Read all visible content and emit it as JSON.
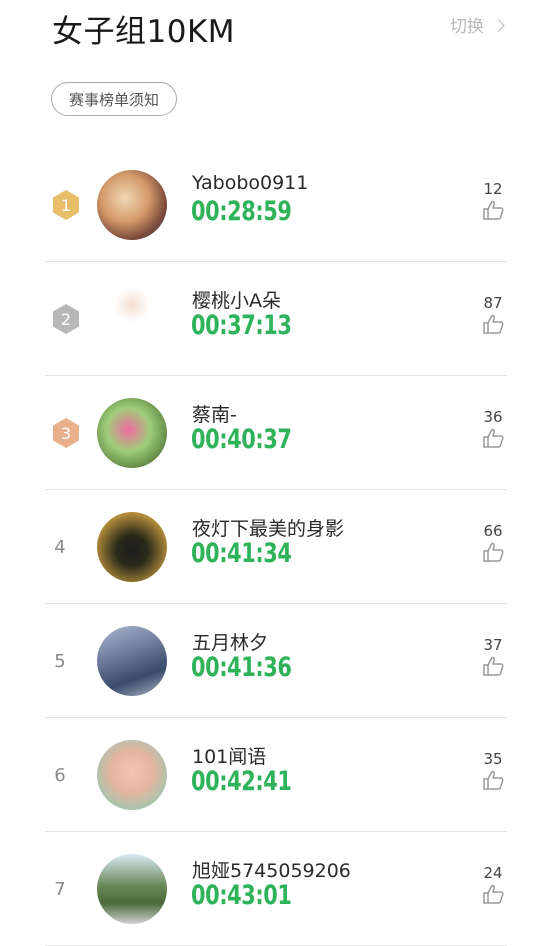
{
  "header": {
    "title": "女子组10KM",
    "switch_label": "切换"
  },
  "notice_button": "赛事榜单须知",
  "rows": [
    {
      "rank": "1",
      "medal": "gold",
      "name": "Yabobo0911",
      "time": "00:28:59",
      "likes": "12"
    },
    {
      "rank": "2",
      "medal": "silver",
      "name": "樱桃小A朵",
      "time": "00:37:13",
      "likes": "87"
    },
    {
      "rank": "3",
      "medal": "bronze",
      "name": "蔡南-",
      "time": "00:40:37",
      "likes": "36"
    },
    {
      "rank": "4",
      "medal": null,
      "name": "夜灯下最美的身影",
      "time": "00:41:34",
      "likes": "66"
    },
    {
      "rank": "5",
      "medal": null,
      "name": "五月林夕",
      "time": "00:41:36",
      "likes": "37"
    },
    {
      "rank": "6",
      "medal": null,
      "name": "101闻语",
      "time": "00:42:41",
      "likes": "35"
    },
    {
      "rank": "7",
      "medal": null,
      "name": "旭娅5745059206",
      "time": "00:43:01",
      "likes": "24"
    }
  ],
  "colors": {
    "time": "#2fb35a",
    "gold": "#e8be6a",
    "silver": "#b7b7b7",
    "bronze": "#e9b08c"
  },
  "icons": {
    "like": "thumbs-up-icon",
    "switch": "chevron-right-icon"
  }
}
